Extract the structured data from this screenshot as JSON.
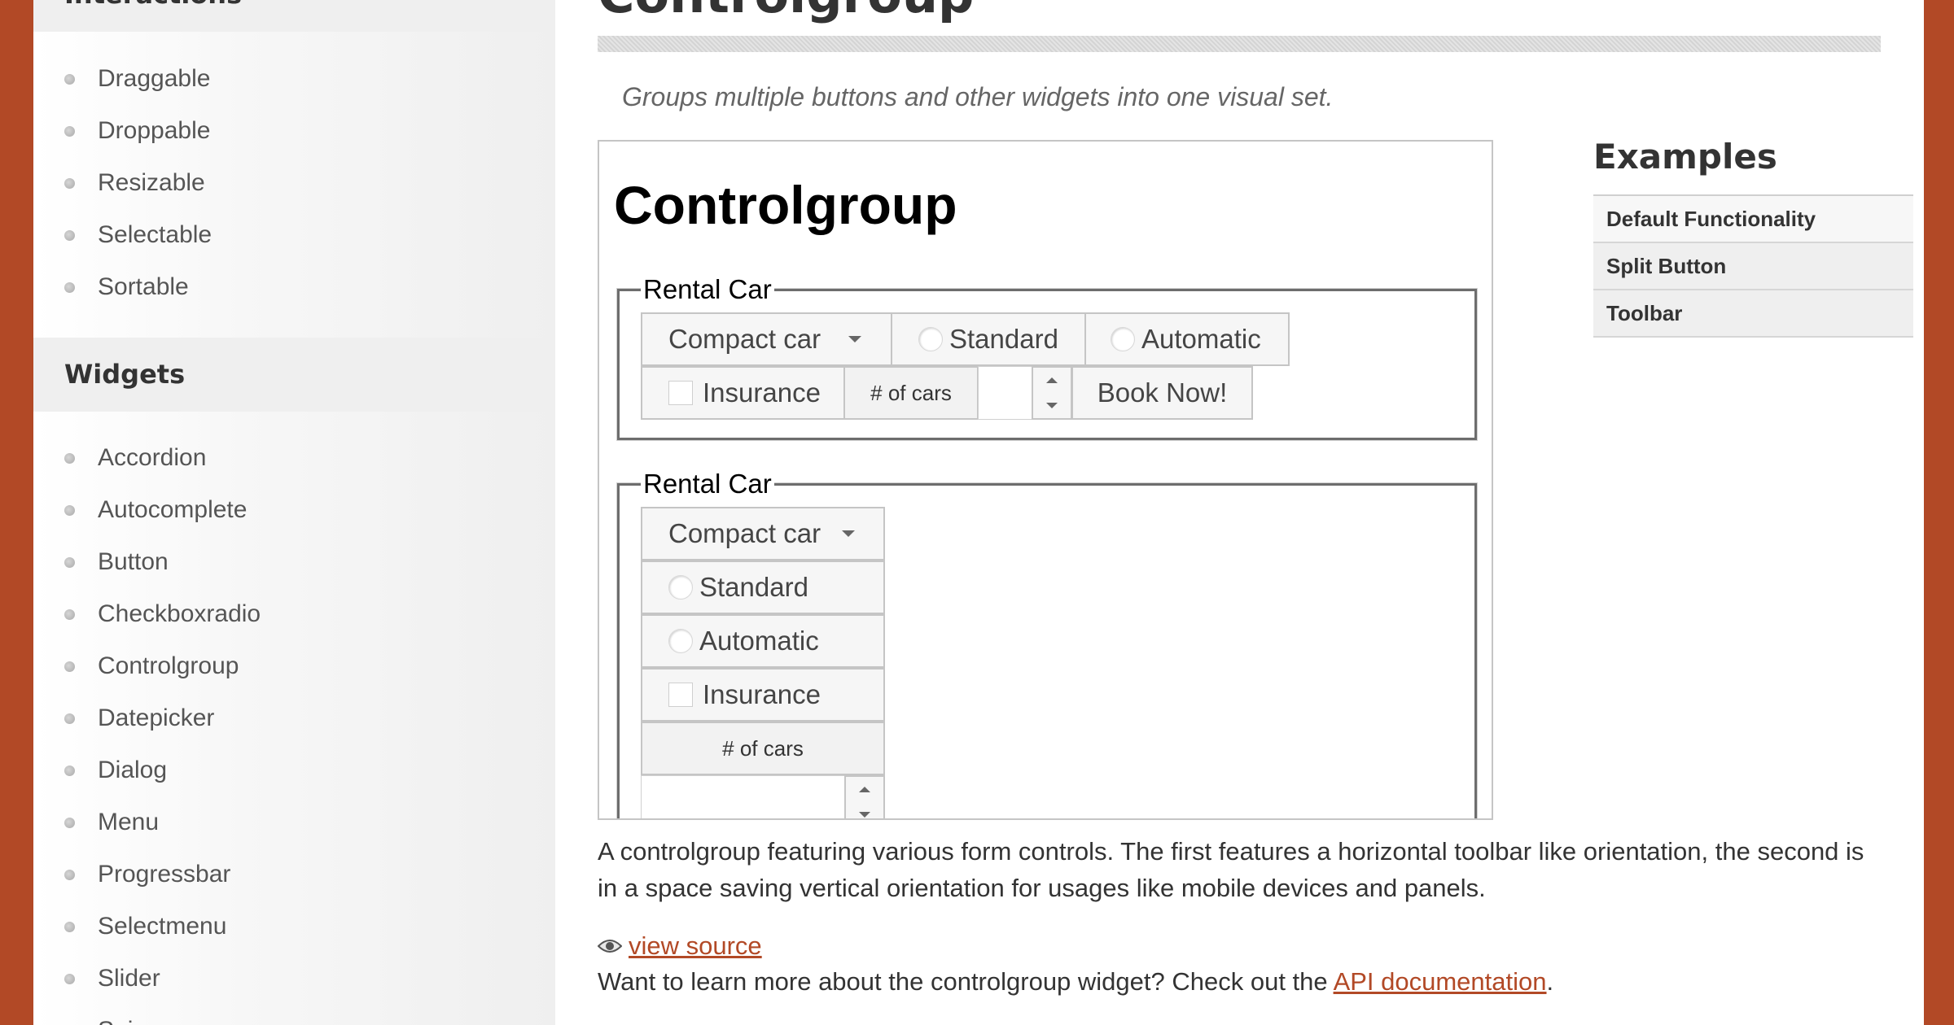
{
  "sidebar": {
    "interactions_heading": "Interactions",
    "interactions": [
      "Draggable",
      "Droppable",
      "Resizable",
      "Selectable",
      "Sortable"
    ],
    "widgets_heading": "Widgets",
    "widgets": [
      "Accordion",
      "Autocomplete",
      "Button",
      "Checkboxradio",
      "Controlgroup",
      "Datepicker",
      "Dialog",
      "Menu",
      "Progressbar",
      "Selectmenu",
      "Slider",
      "Spinner"
    ]
  },
  "main": {
    "title": "Controlgroup",
    "tagline": "Groups multiple buttons and other widgets into one visual set.",
    "demo": {
      "heading": "Controlgroup",
      "group1": {
        "legend": "Rental Car",
        "select_value": "Compact car",
        "radio1": "Standard",
        "radio2": "Automatic",
        "checkbox": "Insurance",
        "spinner_label": "# of cars",
        "spinner_value": "",
        "book_button": "Book Now!"
      },
      "group2": {
        "legend": "Rental Car",
        "select_value": "Compact car",
        "radio1": "Standard",
        "radio2": "Automatic",
        "checkbox": "Insurance",
        "spinner_label": "# of cars",
        "spinner_value": ""
      }
    },
    "description": "A controlgroup featuring various form controls. The first features a horizontal toolbar like orientation, the second is in a space saving vertical orientation for usages like mobile devices and panels.",
    "view_source": "view source",
    "learn_more_prefix": "Want to learn more about the controlgroup widget? Check out the ",
    "api_link": "API documentation",
    "learn_more_suffix": "."
  },
  "examples": {
    "title": "Examples",
    "items": [
      "Default Functionality",
      "Split Button",
      "Toolbar"
    ]
  },
  "colors": {
    "accent": "#b24926",
    "sidebar_heading_bg": "#efefef",
    "button_bg": "#f6f6f6",
    "button_border": "#c5c5c5"
  }
}
